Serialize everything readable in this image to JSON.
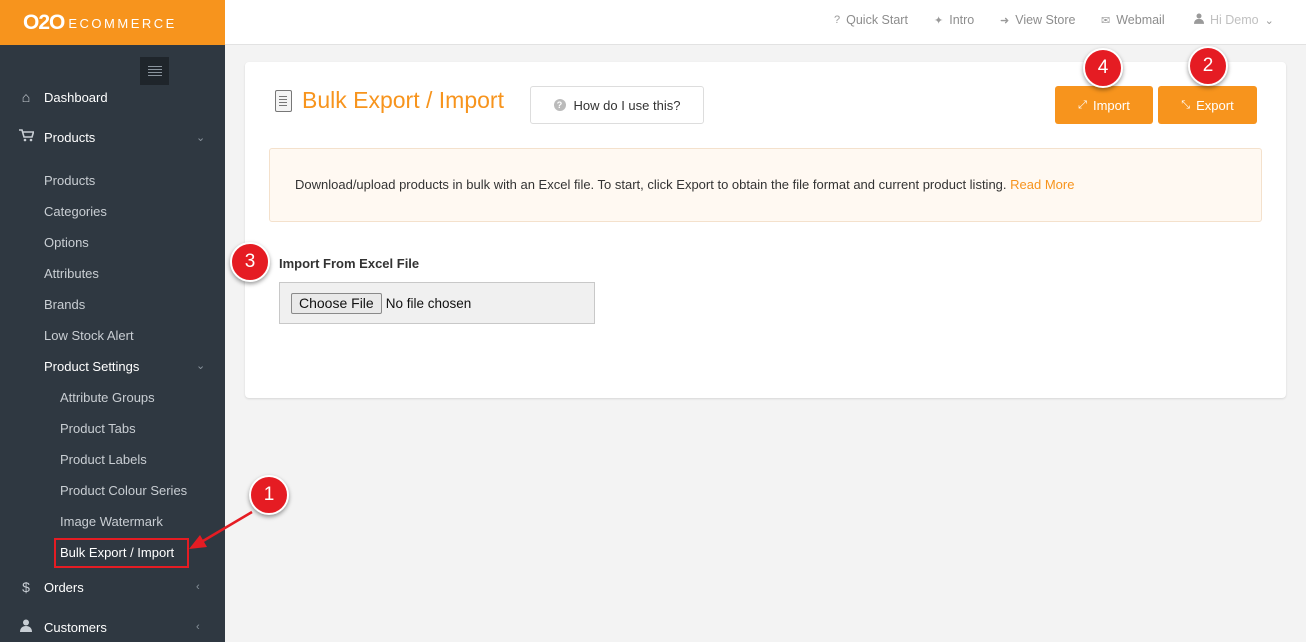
{
  "brand": {
    "logo": "O2O",
    "sub": "ECOMMERCE"
  },
  "sidebar": {
    "nav": [
      {
        "label": "Dashboard",
        "icon": "home-icon"
      },
      {
        "label": "Products",
        "icon": "cart-icon"
      },
      {
        "label": "Orders",
        "icon": "dollar-icon"
      },
      {
        "label": "Customers",
        "icon": "user-icon"
      }
    ],
    "products_sub": [
      "Products",
      "Categories",
      "Options",
      "Attributes",
      "Brands",
      "Low Stock Alert",
      "Product Settings"
    ],
    "settings_sub": [
      "Attribute Groups",
      "Product Tabs",
      "Product Labels",
      "Product Colour Series",
      "Image Watermark",
      "Bulk Export / Import"
    ]
  },
  "topbar": {
    "links": [
      "Quick Start",
      "Intro",
      "View Store",
      "Webmail"
    ],
    "user": "Hi Demo"
  },
  "page": {
    "title": "Bulk Export / Import",
    "help_label": "How do I use this?",
    "import_label": "Import",
    "export_label": "Export",
    "info_text": "Download/upload products in bulk with an Excel file. To start, click Export to obtain the file format and current product listing.",
    "info_link": "Read More",
    "import_field_label": "Import From Excel File",
    "choose_file": "Choose File",
    "no_file": "No file chosen"
  },
  "callouts": [
    "1",
    "2",
    "3",
    "4"
  ],
  "colors": {
    "accent": "#f7941d",
    "sidebar": "#2f3841",
    "callout": "#e51c23"
  }
}
